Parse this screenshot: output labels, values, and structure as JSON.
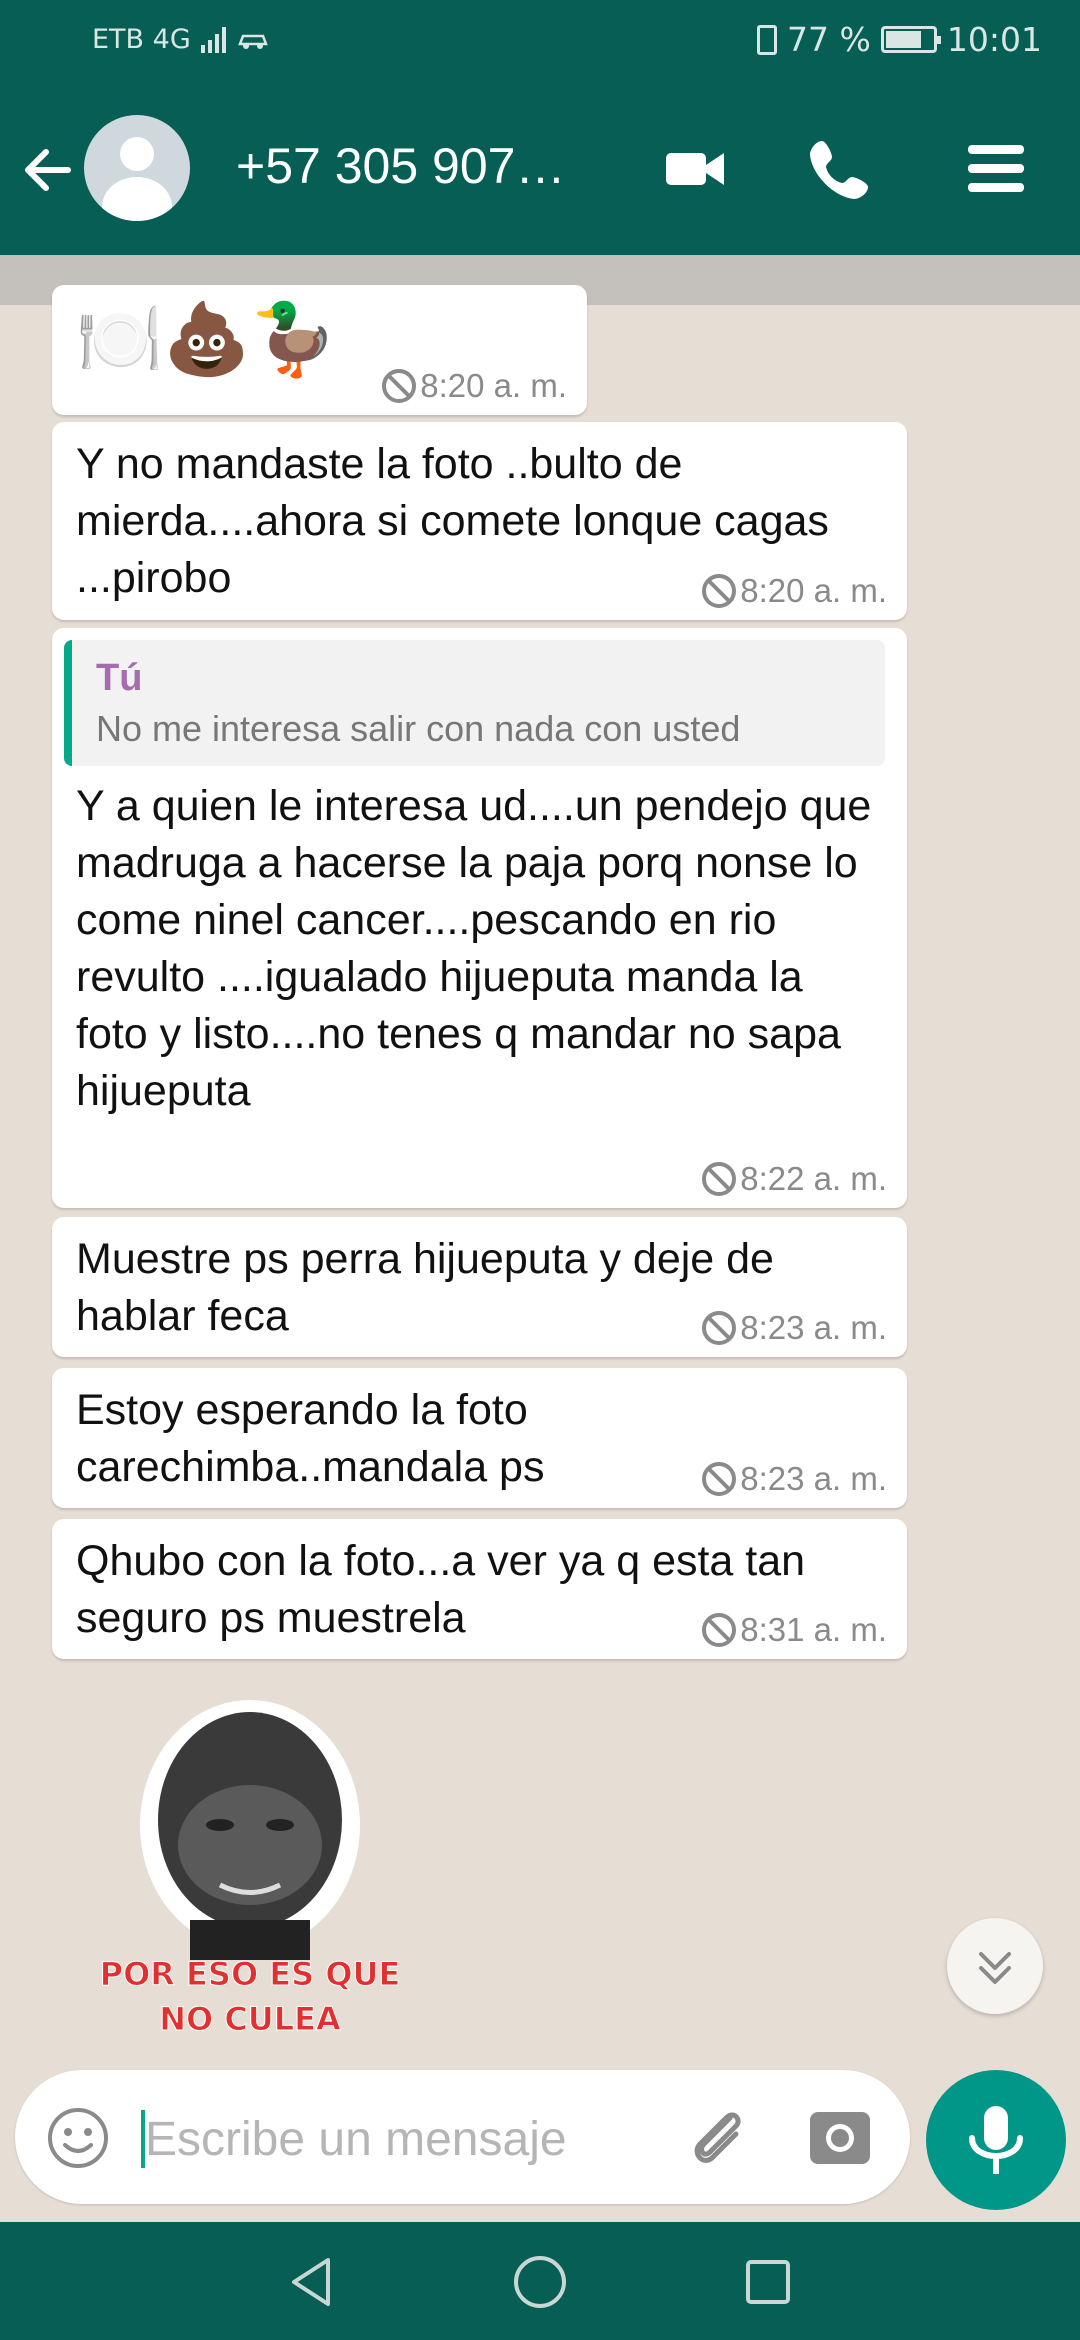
{
  "status_bar": {
    "carrier": "ETB 4G",
    "network_badge": "4G",
    "battery": "77 %",
    "time": "10:01"
  },
  "header": {
    "contact": "+57 305 907…",
    "back_icon": "arrow-left-icon",
    "video_icon": "video-camera-icon",
    "call_icon": "phone-icon",
    "menu_icon": "menu-icon"
  },
  "messages": [
    {
      "emojis": "🍽️💩🦆",
      "time": "8:20 a. m."
    },
    {
      "text": "Y no mandaste la foto ..bulto de mierda....ahora si comete lonque cagas ...pirobo",
      "time": "8:20 a. m."
    },
    {
      "quote_author": "Tú",
      "quote_text": "No me interesa salir con nada con usted",
      "text": "Y a quien le interesa ud....un pendejo que madruga a hacerse la paja porq nonse lo come ninel cancer....pescando en rio revulto ....igualado hijueputa manda la foto y listo....no tenes q mandar no sapa hijueputa",
      "time": "8:22 a. m."
    },
    {
      "text": "Muestre ps perra hijueputa y deje de hablar feca",
      "time": "8:23 a. m."
    },
    {
      "text": "Estoy esperando la foto carechimba..mandala ps",
      "time": "8:23 a. m."
    },
    {
      "text": "Qhubo con la foto...a ver ya q esta tan seguro ps muestrela",
      "time": "8:31 a. m."
    }
  ],
  "sticker": {
    "line1": "POR ESO ES QUE",
    "line2": "NO CULEA"
  },
  "composer": {
    "placeholder": "Escribe un mensaje"
  },
  "colors": {
    "header": "#075e54",
    "accent": "#009688",
    "chat_bg": "#e6ddd4",
    "quote_author": "#a66bb0"
  }
}
